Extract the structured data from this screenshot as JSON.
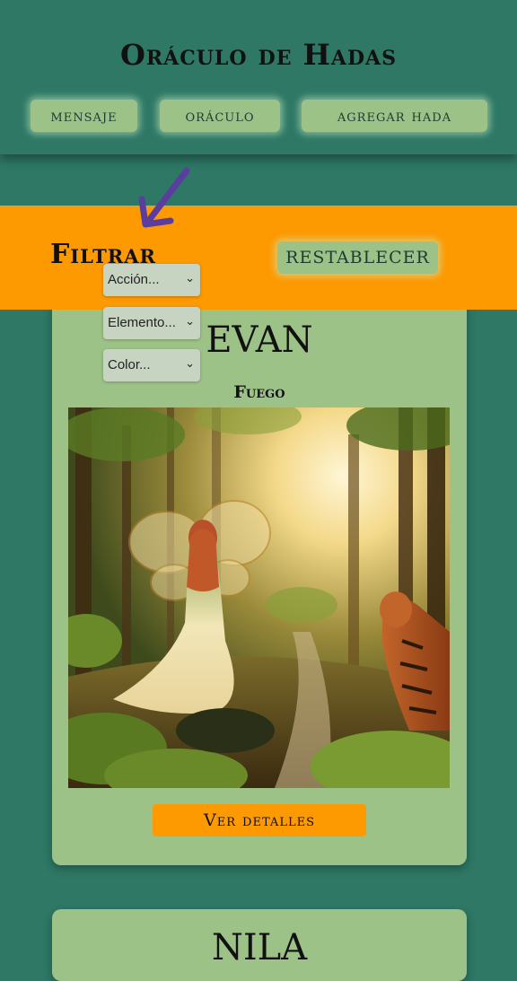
{
  "header": {
    "title": "Oráculo de Hadas",
    "nav": [
      {
        "label": "mensaje"
      },
      {
        "label": "oráculo"
      },
      {
        "label": "agregar hada"
      }
    ]
  },
  "filter": {
    "title": "Filtrar",
    "reset_label": "RESTABLECER",
    "selects": [
      {
        "value": "Acción..."
      },
      {
        "value": "Elemento..."
      },
      {
        "value": "Color..."
      }
    ]
  },
  "cards": [
    {
      "name": "EVAN",
      "element": "Fuego",
      "details_label": "Ver detalles"
    },
    {
      "name": "NILA"
    }
  ],
  "colors": {
    "background": "#2e7865",
    "accent": "#fd9901",
    "card": "#9dc287",
    "arrow": "#5a3d9e"
  }
}
